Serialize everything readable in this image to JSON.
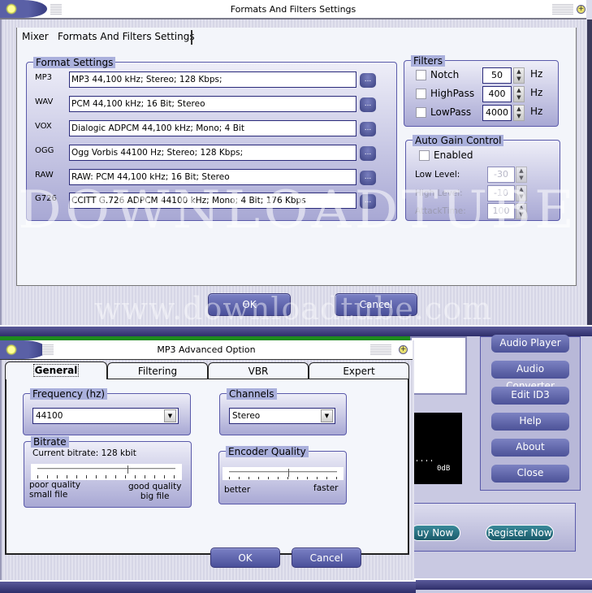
{
  "main_window": {
    "title": "Formats And Filters Settings",
    "tabs": [
      {
        "label": "Mixer"
      },
      {
        "label": "Formats And Filters Settings"
      }
    ],
    "format_settings": {
      "legend": "Format Settings",
      "rows": [
        {
          "label": "MP3",
          "value": "MP3 44,100 kHz; Stereo;  128 Kbps;"
        },
        {
          "label": "WAV",
          "value": "PCM 44,100 kHz; 16 Bit; Stereo"
        },
        {
          "label": "VOX",
          "value": "Dialogic ADPCM 44,100 kHz; Mono; 4 Bit"
        },
        {
          "label": "OGG",
          "value": "Ogg Vorbis 44100 Hz; Stereo; 128 Kbps;"
        },
        {
          "label": "RAW",
          "value": "RAW: PCM 44,100 kHz; 16 Bit; Stereo"
        },
        {
          "label": "G726",
          "value": "CCITT G.726 ADPCM 44100 kHz; Mono; 4 Bit; 176 Kbps"
        }
      ],
      "browse_label": "..."
    },
    "filters": {
      "legend": "Filters",
      "unit": "Hz",
      "items": [
        {
          "label": "Notch",
          "value": "50",
          "checked": false
        },
        {
          "label": "HighPass",
          "value": "400",
          "checked": false
        },
        {
          "label": "LowPass",
          "value": "4000",
          "checked": false
        }
      ]
    },
    "agc": {
      "legend": "Auto Gain Control",
      "enabled_label": "Enabled",
      "enabled": false,
      "fields": [
        {
          "label": "Low Level:",
          "value": "-30"
        },
        {
          "label": "High Level:",
          "value": "-10"
        },
        {
          "label": "AttackTime:",
          "value": "100"
        }
      ]
    },
    "ok_label": "OK",
    "cancel_label": "Cancel"
  },
  "watermark": {
    "big": "DOWNLOADTUBE",
    "url": "www.downloadtube.com"
  },
  "mp3_dialog": {
    "title": "MP3 Advanced Option",
    "tabs": [
      {
        "label": "General",
        "active": true
      },
      {
        "label": "Filtering"
      },
      {
        "label": "VBR"
      },
      {
        "label": "Expert"
      }
    ],
    "frequency": {
      "legend": "Frequency (hz)",
      "value": "44100"
    },
    "channels": {
      "legend": "Channels",
      "value": "Stereo"
    },
    "bitrate": {
      "legend": "Bitrate",
      "current": "Current bitrate: 128 kbit",
      "left_label_1": "poor quality",
      "left_label_2": "small file",
      "right_label_1": "good quality",
      "right_label_2": "big file",
      "position_fraction": 0.65
    },
    "encoder_quality": {
      "legend": "Encoder Quality",
      "left_label": "better",
      "right_label": "faster",
      "position_fraction": 0.55
    },
    "ok_label": "OK",
    "cancel_label": "Cancel"
  },
  "background_app": {
    "side_buttons": [
      "Audio Player",
      "Audio Converter",
      "Edit ID3",
      "Help",
      "About",
      "Close"
    ],
    "meter_label": "0dB",
    "buy_label": "uy Now",
    "register_label": "Register Now"
  }
}
